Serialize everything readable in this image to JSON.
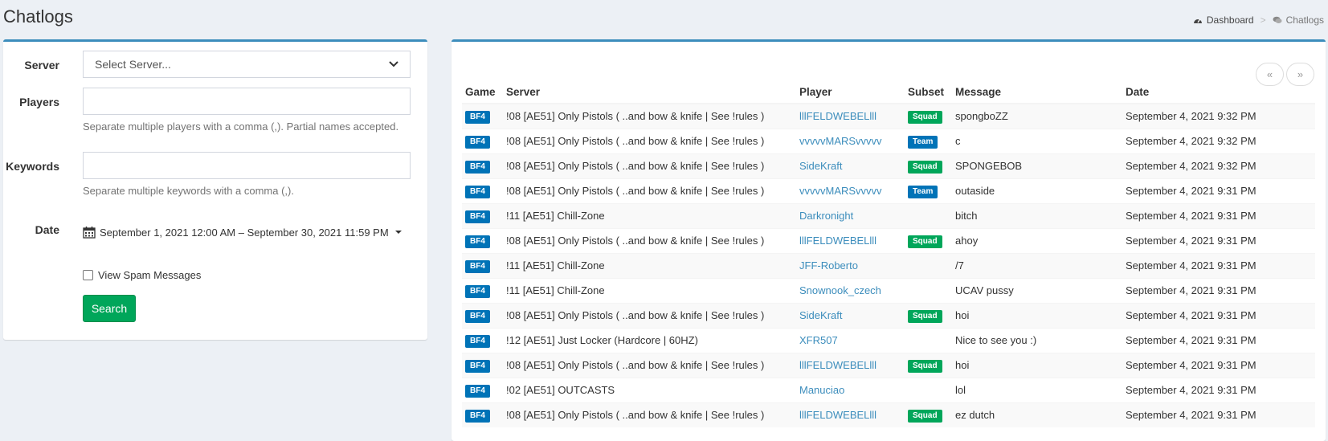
{
  "header": {
    "title": "Chatlogs"
  },
  "breadcrumb": {
    "dashboard": "Dashboard",
    "separator": ">",
    "current": "Chatlogs"
  },
  "filter": {
    "server_label": "Server",
    "server_value": "Select Server...",
    "players_label": "Players",
    "players_value": "",
    "players_help": "Separate multiple players with a comma (,). Partial names accepted.",
    "keywords_label": "Keywords",
    "keywords_value": "",
    "keywords_help": "Separate multiple keywords with a comma (,).",
    "date_label": "Date",
    "date_value": "September 1, 2021 12:00 AM – September 30, 2021 11:59 PM",
    "spam_label": "View Spam Messages",
    "spam_checked": false,
    "search_label": "Search"
  },
  "pager": {
    "prev": "«",
    "next": "»"
  },
  "table": {
    "columns": [
      "Game",
      "Server",
      "Player",
      "Subset",
      "Message",
      "Date"
    ],
    "rows": [
      {
        "game": "BF4",
        "server": "!08 [AE51] Only Pistols ( ..and bow & knife | See !rules )",
        "player": "lllFELDWEBELlll",
        "subset": "Squad",
        "message": "spongboZZ",
        "date": "September 4, 2021 9:32 PM"
      },
      {
        "game": "BF4",
        "server": "!08 [AE51] Only Pistols ( ..and bow & knife | See !rules )",
        "player": "vvvvvMARSvvvvv",
        "subset": "Team",
        "message": "c",
        "date": "September 4, 2021 9:32 PM"
      },
      {
        "game": "BF4",
        "server": "!08 [AE51] Only Pistols ( ..and bow & knife | See !rules )",
        "player": "SideKraft",
        "subset": "Squad",
        "message": "SPONGEBOB",
        "date": "September 4, 2021 9:32 PM"
      },
      {
        "game": "BF4",
        "server": "!08 [AE51] Only Pistols ( ..and bow & knife | See !rules )",
        "player": "vvvvvMARSvvvvv",
        "subset": "Team",
        "message": "outaside",
        "date": "September 4, 2021 9:31 PM"
      },
      {
        "game": "BF4",
        "server": "!11 [AE51] Chill-Zone",
        "player": "Darkronight",
        "subset": "",
        "message": "bitch",
        "date": "September 4, 2021 9:31 PM"
      },
      {
        "game": "BF4",
        "server": "!08 [AE51] Only Pistols ( ..and bow & knife | See !rules )",
        "player": "lllFELDWEBELlll",
        "subset": "Squad",
        "message": "ahoy",
        "date": "September 4, 2021 9:31 PM"
      },
      {
        "game": "BF4",
        "server": "!11 [AE51] Chill-Zone",
        "player": "JFF-Roberto",
        "subset": "",
        "message": "/7",
        "date": "September 4, 2021 9:31 PM"
      },
      {
        "game": "BF4",
        "server": "!11 [AE51] Chill-Zone",
        "player": "Snownook_czech",
        "subset": "",
        "message": "UCAV pussy",
        "date": "September 4, 2021 9:31 PM"
      },
      {
        "game": "BF4",
        "server": "!08 [AE51] Only Pistols ( ..and bow & knife | See !rules )",
        "player": "SideKraft",
        "subset": "Squad",
        "message": "hoi",
        "date": "September 4, 2021 9:31 PM"
      },
      {
        "game": "BF4",
        "server": "!12 [AE51] Just Locker (Hardcore | 60HZ)",
        "player": "XFR507",
        "subset": "",
        "message": "Nice to see you :)",
        "date": "September 4, 2021 9:31 PM"
      },
      {
        "game": "BF4",
        "server": "!08 [AE51] Only Pistols ( ..and bow & knife | See !rules )",
        "player": "lllFELDWEBELlll",
        "subset": "Squad",
        "message": "hoi",
        "date": "September 4, 2021 9:31 PM"
      },
      {
        "game": "BF4",
        "server": "!02 [AE51] OUTCASTS",
        "player": "Manuciao",
        "subset": "",
        "message": "lol",
        "date": "September 4, 2021 9:31 PM"
      },
      {
        "game": "BF4",
        "server": "!08 [AE51] Only Pistols ( ..and bow & knife | See !rules )",
        "player": "lllFELDWEBELlll",
        "subset": "Squad",
        "message": "ez dutch",
        "date": "September 4, 2021 9:31 PM"
      }
    ]
  },
  "colors": {
    "accent": "#3c8dbc",
    "squad": "#00a65a",
    "team": "#0073b7",
    "game": "#0073b7",
    "search_button": "#00a65a"
  },
  "icons": {
    "dashboard": "tachometer-icon",
    "chatlogs": "comments-icon",
    "date": "calendar-icon",
    "select": "chevron-down-icon"
  }
}
